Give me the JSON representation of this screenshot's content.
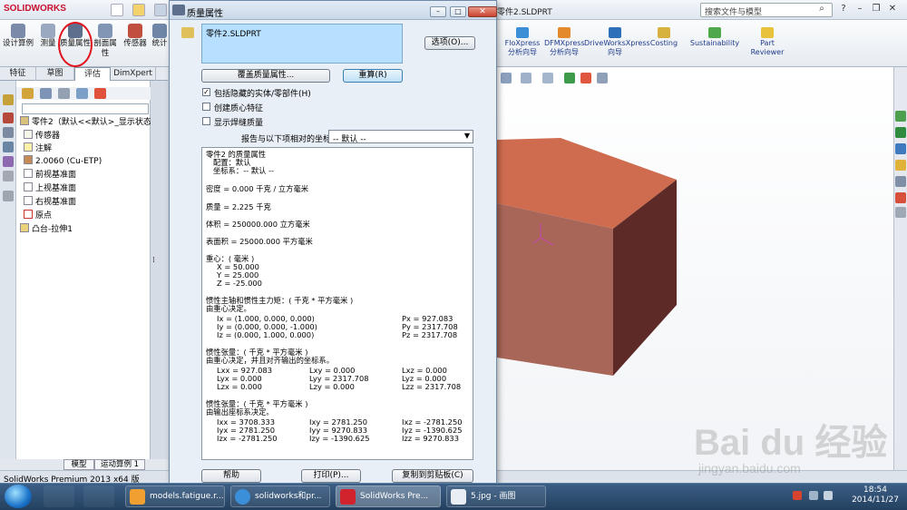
{
  "app": {
    "logo": "SOLIDWORKS",
    "doc_title": "零件2.SLDPRT",
    "search_placeholder": "搜索文件与模型"
  },
  "ribbon": {
    "left_buttons": [
      "设计算例",
      "测量",
      "质量属性",
      "剖面属性",
      "传感器",
      "统计"
    ],
    "right_buttons": [
      "FloXpress 分析向导",
      "DFMXpress 分析向导",
      "DriveWorksXpress 向导",
      "Costing",
      "Sustainability",
      "Part Reviewer"
    ]
  },
  "tabs": [
    "特征",
    "草图",
    "评估",
    "DimXpert"
  ],
  "active_tab": "评估",
  "tree": {
    "root": "零件2（默认<<默认>_显示状态",
    "items": [
      "传感器",
      "注解",
      "2.0060 (Cu-ETP)",
      "前视基准面",
      "上视基准面",
      "右视基准面",
      "原点",
      "凸台-拉伸1"
    ]
  },
  "bottom_tabs": [
    "模型",
    "运动算例 1"
  ],
  "status_text": "SolidWorks Premium 2013 x64 版",
  "dialog": {
    "title": "质量属性",
    "selected_part": "零件2.SLDPRT",
    "options_button": "选项(O)...",
    "override_button": "覆盖质量属性...",
    "recalc_button": "重算(R)",
    "checkboxes": [
      {
        "label": "包括隐藏的实体/零部件(H)",
        "checked": true
      },
      {
        "label": "创建质心特征",
        "checked": false
      },
      {
        "label": "显示焊缝质量",
        "checked": false
      }
    ],
    "coord_label": "报告与以下项相对的坐标值:",
    "coord_value": "-- 默认 --",
    "report": {
      "header": "零件2 的质量属性",
      "config": "配置：默认",
      "coordsys": "坐标系：-- 默认 --",
      "density": "密度 = 0.000 千克 / 立方毫米",
      "mass": "质量 = 2.225 千克",
      "volume": "体积 = 250000.000 立方毫米",
      "area": "表面积 = 25000.000  平方毫米",
      "com_title": "重心：( 毫米 )",
      "com_x": "X = 50.000",
      "com_y": "Y = 25.000",
      "com_z": "Z = -25.000",
      "principal_title": "惯性主轴和惯性主力矩：( 千克 * 平方毫米 )",
      "principal_sub": "由重心决定。",
      "ix": "Ix = (1.000, 0.000, 0.000)",
      "iy": "Iy = (0.000, 0.000, -1.000)",
      "iz": "Iz = (0.000, 1.000, 0.000)",
      "px": "Px = 927.083",
      "py": "Py = 2317.708",
      "pz": "Pz = 2317.708",
      "tensor1_title": "惯性张量：( 千克 * 平方毫米 )",
      "tensor1_sub": "由重心决定，并且对齐输出的坐标系。",
      "t1": [
        [
          "Lxx = 927.083",
          "Lxy = 0.000",
          "Lxz = 0.000"
        ],
        [
          "Lyx = 0.000",
          "Lyy = 2317.708",
          "Lyz = 0.000"
        ],
        [
          "Lzx = 0.000",
          "Lzy = 0.000",
          "Lzz = 2317.708"
        ]
      ],
      "tensor2_title": "惯性张量：( 千克 * 平方毫米 )",
      "tensor2_sub": "由输出座标系决定。",
      "t2": [
        [
          "Ixx = 3708.333",
          "Ixy = 2781.250",
          "Ixz = -2781.250"
        ],
        [
          "Iyx = 2781.250",
          "Iyy = 9270.833",
          "Iyz = -1390.625"
        ],
        [
          "Izx = -2781.250",
          "Izy = -1390.625",
          "Izz = 9270.833"
        ]
      ]
    },
    "help_button": "帮助",
    "print_button": "打印(P)...",
    "copy_button": "复制到剪贴板(C)"
  },
  "taskbar": {
    "items": [
      "models.fatigue.r...",
      "solidworks和pr...",
      "SolidWorks Pre...",
      "5.jpg - 画图"
    ],
    "time": "18:54",
    "date": "2014/11/27"
  },
  "watermark": {
    "main": "Bai du 经验",
    "sub": "jingyan.baidu.com"
  },
  "colors": {
    "block_top": "#cf6c4f",
    "block_front": "#a86659",
    "block_side": "#5e2a28",
    "dialog_blue": "#b7dfff",
    "highlight_circle": "#e0141e"
  }
}
